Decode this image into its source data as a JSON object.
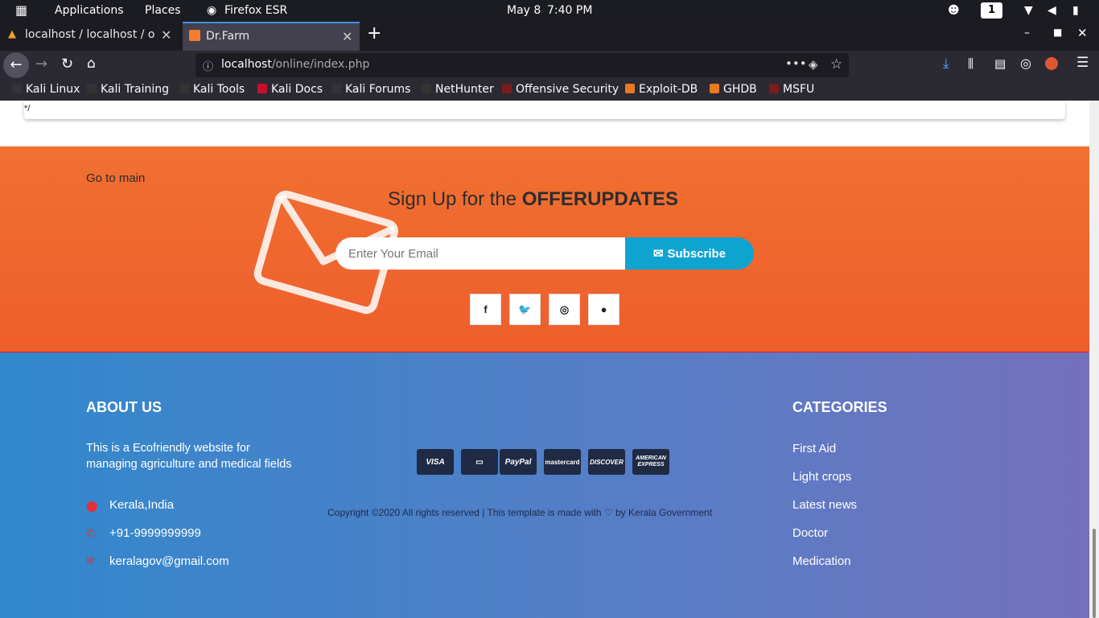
{
  "topbar": {
    "applications": "Applications",
    "places": "Places",
    "app_name": "Firefox ESR",
    "date": "May 8",
    "time": "7:40 PM",
    "workspace": "1"
  },
  "tabs": [
    {
      "label": "localhost / localhost / onli"
    },
    {
      "label": "Dr.Farm"
    }
  ],
  "url": {
    "host": "localhost",
    "path": "/online/index.php"
  },
  "bookmarks": [
    "Kali Linux",
    "Kali Training",
    "Kali Tools",
    "Kali Docs",
    "Kali Forums",
    "NetHunter",
    "Offensive Security",
    "Exploit-DB",
    "GHDB",
    "MSFU"
  ],
  "page": {
    "code_snippet": "*/",
    "go_to_main": "Go to main",
    "signup_prefix": "Sign Up for the ",
    "signup_bold": "OFFERUPDATES",
    "email_placeholder": "Enter Your Email",
    "subscribe_label": "Subscribe",
    "social": [
      "facebook-icon",
      "twitter-icon",
      "instagram-icon",
      "github-icon"
    ],
    "about": {
      "heading": "ABOUT US",
      "text": "This is a Ecofriendly website for managing agriculture and medical fields",
      "location": "Kerala,India",
      "phone": "+91-9999999999",
      "email": "keralagov@gmail.com"
    },
    "payment_cards": [
      "VISA",
      "card",
      "PayPal",
      "mastercard",
      "DISCOVER",
      "AMERICAN EXPRESS"
    ],
    "copyright_prefix": "Copyright ©2020 All rights reserved | This template is made with ",
    "copyright_suffix": " by Kerala Government",
    "categories": {
      "heading": "CATEGORIES",
      "items": [
        "First Aid",
        "Light crops",
        "Latest news",
        "Doctor",
        "Medication"
      ]
    }
  },
  "colors": {
    "orange": "#ef6a2e",
    "subscribe": "#0fa3d0",
    "footer_blue": "#3a86cb",
    "footer_purple": "#7470bb"
  }
}
